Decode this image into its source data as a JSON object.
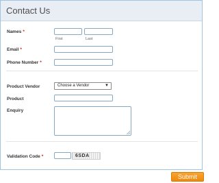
{
  "header": {
    "title": "Contact Us"
  },
  "form": {
    "names": {
      "label": "Names",
      "required": "*",
      "first_label": "First",
      "last_label": "Last",
      "first_value": "",
      "last_value": ""
    },
    "email": {
      "label": "Email",
      "required": "*",
      "value": ""
    },
    "phone": {
      "label": "Phone Number",
      "required": "*",
      "value": ""
    },
    "product_vendor": {
      "label": "Product Vendor",
      "selected": "Choose a Vendor"
    },
    "product": {
      "label": "Product",
      "value": ""
    },
    "enquiry": {
      "label": "Enquiry",
      "value": ""
    },
    "validation": {
      "label": "Validation Code",
      "required": "*",
      "captcha_text": "6SDA",
      "value": ""
    },
    "submit_label": "Submit"
  },
  "colors": {
    "accent": "#ee8a0c",
    "required": "#dd1111",
    "border": "#9fc3e0"
  }
}
